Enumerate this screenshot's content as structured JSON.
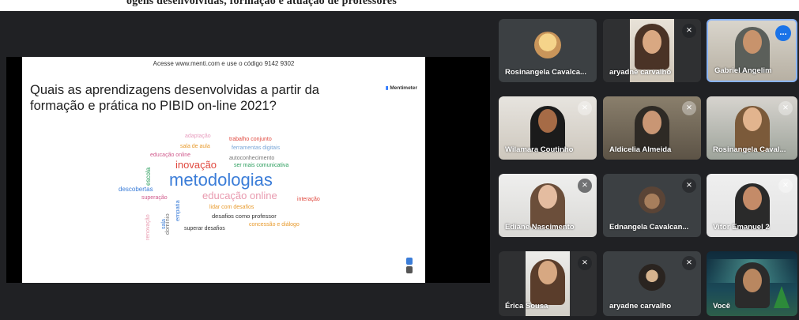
{
  "doc_caption": "ogens desenvolvidas, formação e atuação de professores",
  "slide": {
    "hint": "Acesse www.menti.com e use o código 9142 9302",
    "question": "Quais as aprendizagens desenvolvidas a partir da formação e prática no PIBID on-line 2021?",
    "brand": "Mentimeter",
    "words": {
      "adaptacao": "adaptação",
      "trabalho_conjunto": "trabalho conjunto",
      "sala_de_aula": "sala de aula",
      "ferramentas_digitais": "ferramentas digitais",
      "educacao_online_small": "educação online",
      "autoconhecimento": "autoconhecimento",
      "inovacao": "inovação",
      "ser_mais_comunicativa": "ser mais comunicativa",
      "escola": "escola",
      "metodologias": "metodologias",
      "descobertas": "descobertas",
      "superacao": "superação",
      "educacao_online_big": "educação online",
      "interacao": "interação",
      "lidar_com_desafios": "lidar com desafios",
      "desafios_como_professor": "desafios como professor",
      "concessao_e_dialogo": "concessão e diálogo",
      "superar_desafios": "superar desafios",
      "renovacao": "renovação",
      "dominio": "domínio",
      "empatia": "empatia",
      "sala": "sala"
    }
  },
  "participants": [
    {
      "name": "Rosinangela Cavalca...",
      "muted": false
    },
    {
      "name": "aryadne carvalho",
      "muted": true
    },
    {
      "name": "Gabriel Angelim",
      "muted": false,
      "more": "..."
    },
    {
      "name": "Wilamara Coutinho",
      "muted": true
    },
    {
      "name": "Aldicelia Almeida",
      "muted": true
    },
    {
      "name": "Rosinangela Caval...",
      "muted": true
    },
    {
      "name": "Ediane Nascimento",
      "muted": true
    },
    {
      "name": "Ednangela Cavalcan...",
      "muted": true
    },
    {
      "name": "Vitor Emanuel 2",
      "muted": true
    },
    {
      "name": "Érica Sousa",
      "muted": true
    },
    {
      "name": "aryadne carvalho",
      "muted": true
    },
    {
      "name": "Você",
      "muted": false
    }
  ],
  "icons": {
    "mute": "mic-off-icon",
    "more": "more-options-icon"
  },
  "colors": {
    "background": "#202124",
    "tile": "#3c4043",
    "accent": "#1a73e8"
  }
}
